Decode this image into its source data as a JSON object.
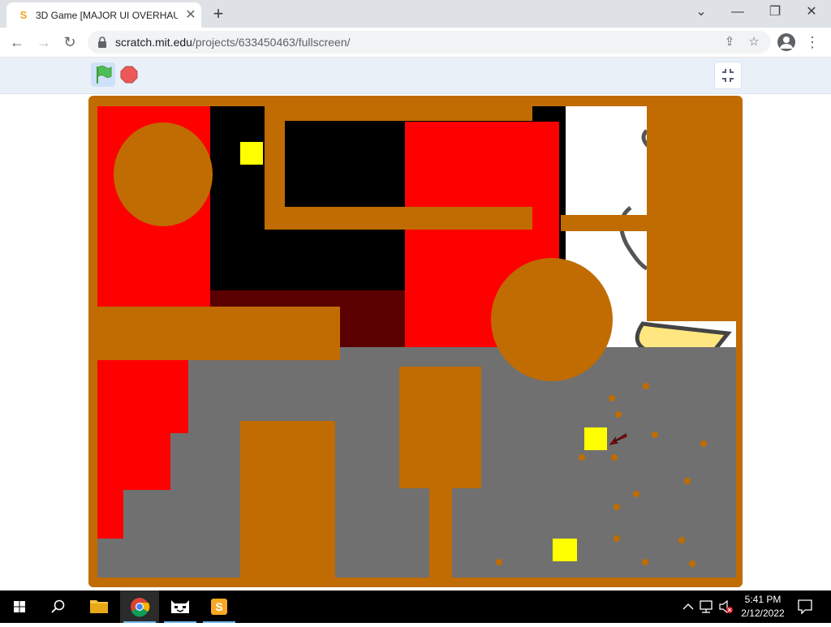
{
  "browser": {
    "tab_title": "3D Game [MAJOR UI OVERHAUL",
    "tab_favicon": "scratch-favicon",
    "url_host": "scratch.mit.edu",
    "url_path": "/projects/633450463/fullscreen/"
  },
  "icons": {
    "back": "←",
    "forward": "→",
    "reload": "↻",
    "tab_close": "✕",
    "new_tab": "+",
    "minimize": "—",
    "restore": "❐",
    "close": "✕",
    "list_tabs": "⌄",
    "share": "⇪",
    "star": "☆",
    "menu": "⋮"
  },
  "scratch": {
    "green_flag": "green-flag",
    "stop": "stop-sign",
    "exit_fullscreen": "exit-fullscreen"
  },
  "taskbar": {
    "time": "5:41 PM",
    "date": "2/12/2022",
    "apps": [
      "start",
      "search",
      "file-explorer",
      "chrome",
      "scratch-cat",
      "scratch-desktop"
    ]
  },
  "colors": {
    "stage_brown": "#c06c02",
    "red": "#ff0000",
    "gray": "#707070",
    "yellow": "#ffff00",
    "black": "#000000"
  }
}
